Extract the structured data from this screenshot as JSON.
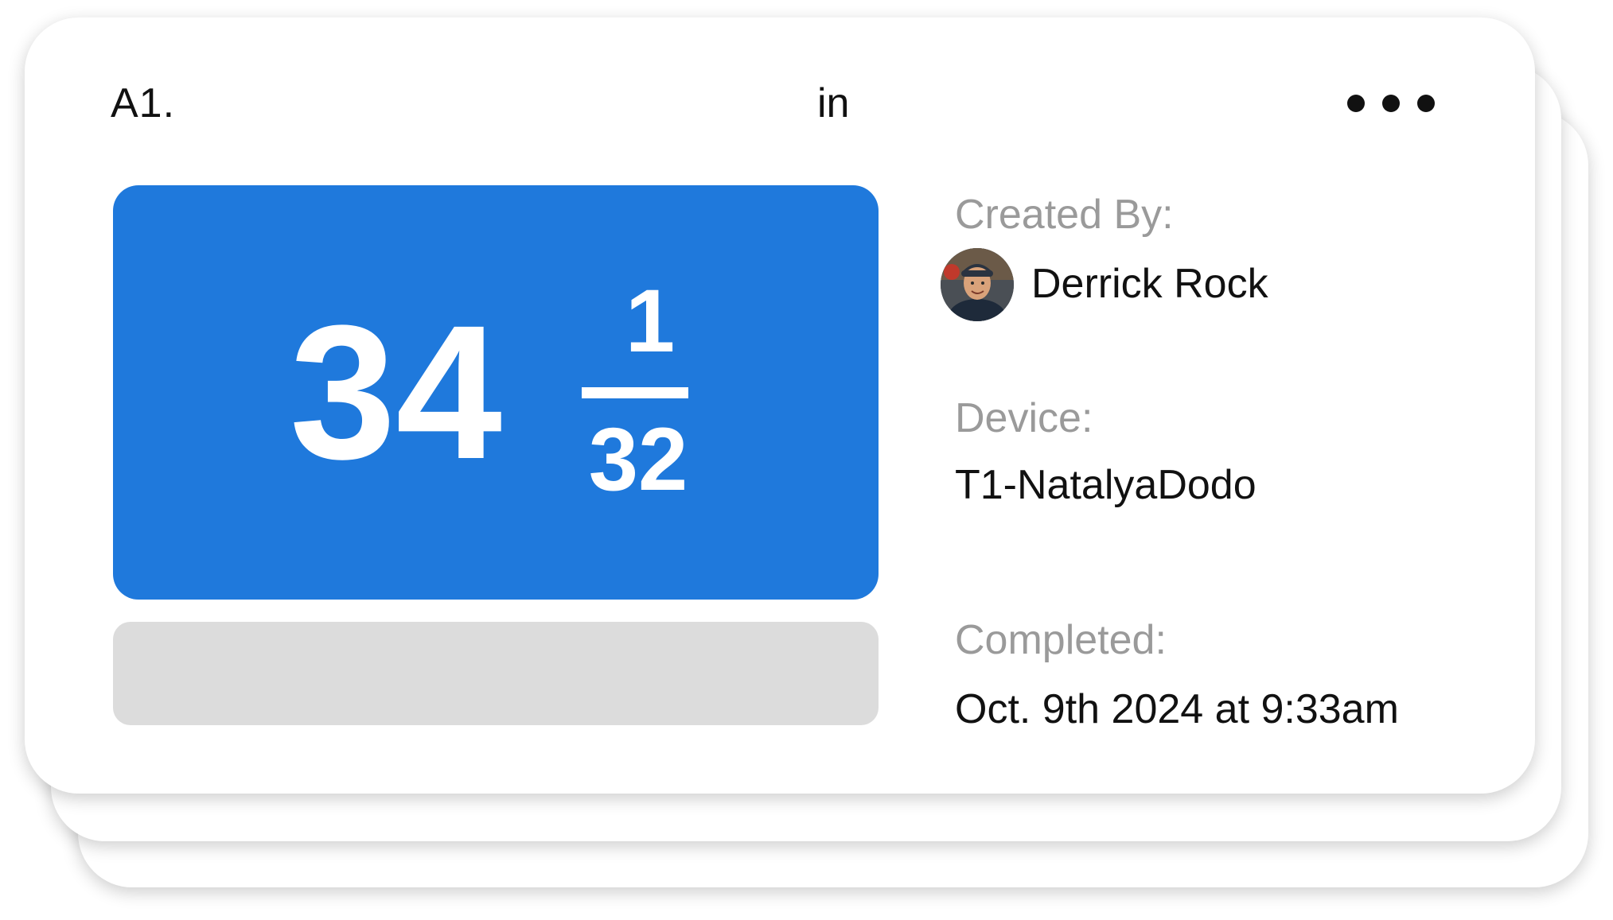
{
  "card": {
    "ref": "A1.",
    "unit": "in",
    "more_icon": "more-horizontal-icon"
  },
  "measurement": {
    "whole": "34",
    "numerator": "1",
    "denominator": "32",
    "color": "#1f79dc"
  },
  "details": {
    "created_by_label": "Created By:",
    "created_by_name": "Derrick Rock",
    "avatar_icon": "user-avatar",
    "device_label": "Device:",
    "device_value": "T1-NatalyaDodo",
    "completed_label": "Completed:",
    "completed_value": "Oct. 9th 2024 at 9:33am"
  }
}
